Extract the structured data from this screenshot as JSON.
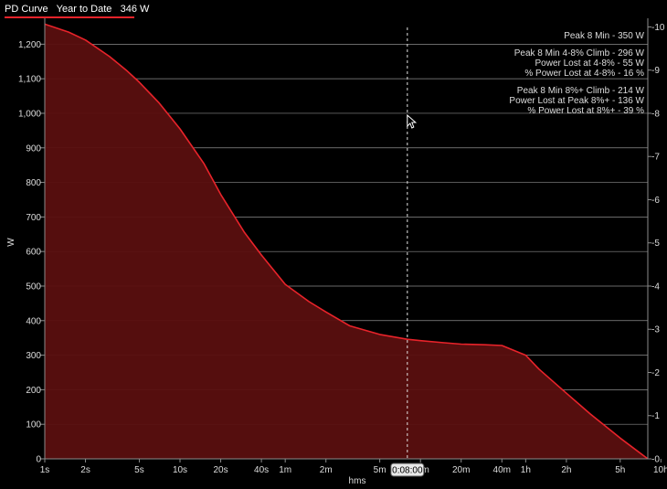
{
  "header": {
    "metric": "PD Curve",
    "range": "Year to Date",
    "value": "346 W",
    "underline_color": "#e8232a"
  },
  "colors": {
    "background": "#000000",
    "line": "#e8232a",
    "fill": "#5a0f0f",
    "grid": "#8c8c8c",
    "text": "#dddddd"
  },
  "chart_data": {
    "type": "area",
    "xlabel": "hms",
    "ylabel": "W",
    "x_scale": "log",
    "x_unit": "seconds",
    "xlim": [
      1,
      28800
    ],
    "ylim": [
      0,
      1275
    ],
    "y_ticks": [
      0,
      100,
      200,
      300,
      400,
      500,
      600,
      700,
      800,
      900,
      1000,
      1100,
      1200
    ],
    "y_tick_labels": [
      "0",
      "100",
      "200",
      "300",
      "400",
      "500",
      "600",
      "700",
      "800",
      "900",
      "1,000",
      "1,100",
      "1,200"
    ],
    "x_ticks": [
      1,
      2,
      5,
      10,
      20,
      40,
      60,
      120,
      300,
      600,
      1200,
      2400,
      3600,
      7200,
      18000,
      36000
    ],
    "x_tick_labels": [
      "1s",
      "2s",
      "5s",
      "10s",
      "20s",
      "40s",
      "1m",
      "2m",
      "5m",
      "10m",
      "20m",
      "40m",
      "1h",
      "2h",
      "5h",
      "10h"
    ],
    "right_axis": {
      "ticks": [
        0,
        1,
        2,
        3,
        4,
        5,
        6,
        7,
        8,
        9,
        10
      ],
      "labels": [
        "0",
        "1",
        "2",
        "3",
        "4",
        "5",
        "6",
        "7",
        "8",
        "9",
        "10"
      ],
      "ylim": [
        0,
        10.2
      ]
    },
    "grid": true,
    "series": [
      {
        "x": [
          1,
          1.5,
          2,
          3,
          4,
          5,
          7,
          10,
          15,
          20,
          30,
          40,
          60,
          90,
          120,
          180,
          300,
          480,
          600,
          900,
          1200,
          1800,
          2400,
          3600,
          4500,
          7200,
          10800,
          18000,
          28800
        ],
        "y": [
          1258,
          1235,
          1212,
          1165,
          1125,
          1090,
          1030,
          955,
          855,
          765,
          655,
          590,
          505,
          455,
          425,
          385,
          360,
          346,
          342,
          336,
          332,
          330,
          328,
          300,
          260,
          190,
          130,
          60,
          0
        ]
      }
    ],
    "cursor": {
      "x": 480,
      "label": "0:08:00"
    },
    "annotations": [
      [
        "Peak 8 Min - 350 W"
      ],
      [
        "Peak 8 Min 4-8% Climb - 296 W",
        "Power Lost at 4-8% - 55 W",
        "% Power Lost at 4-8% - 16 %"
      ],
      [
        "Peak 8 Min 8%+ Climb - 214 W",
        "Power Lost at Peak 8%+ - 136 W",
        "% Power Lost at 8%+ - 39 %"
      ]
    ]
  }
}
